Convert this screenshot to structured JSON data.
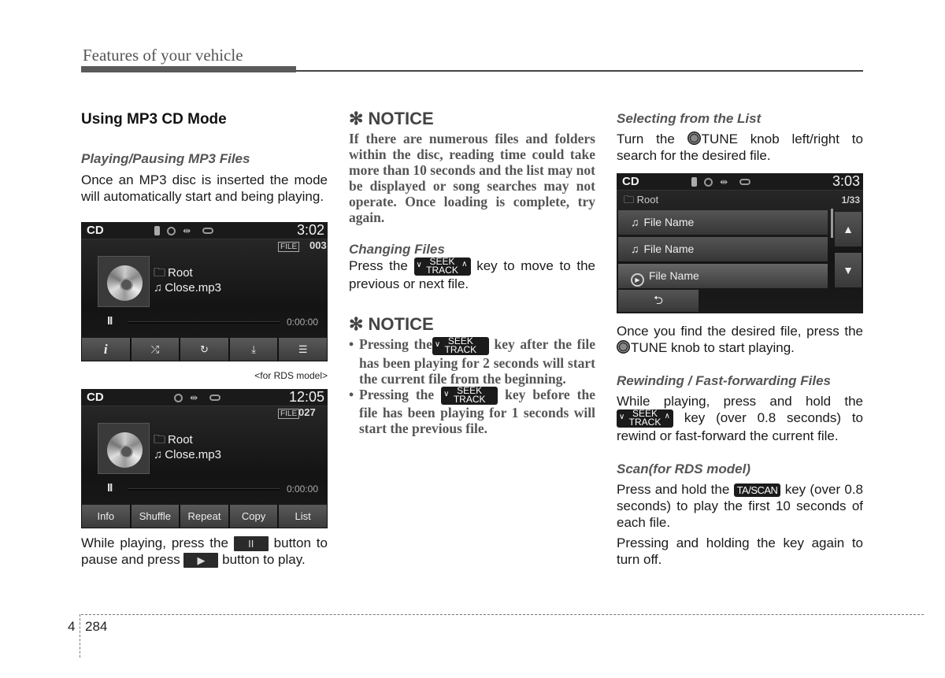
{
  "header": {
    "title": "Features of your vehicle"
  },
  "col1": {
    "section_title": "Using MP3 CD Mode",
    "subhead_play": "Playing/Pausing MP3 Files",
    "intro": "Once an MP3 disc is inserted the mode will automatically start and being playing.",
    "screen1": {
      "mode": "CD",
      "time": "3:02",
      "file_badge": "FILE",
      "file_number": "003",
      "folder": "Root",
      "track": "Close.mp3",
      "elapsed": "0:00:00",
      "pause_glyph": "II",
      "buttons": [
        {
          "name": "info",
          "label": "i"
        },
        {
          "name": "shuffle",
          "label": "⤮"
        },
        {
          "name": "repeat",
          "label": "↻"
        },
        {
          "name": "copy",
          "label": "⤓"
        },
        {
          "name": "list",
          "label": "☰"
        }
      ]
    },
    "caption_rds": "<for RDS model>",
    "screen2": {
      "mode": "CD",
      "time": "12:05",
      "file_badge": "FILE",
      "file_number": "027",
      "folder": "Root",
      "track": "Close.mp3",
      "elapsed": "0:00:00",
      "pause_glyph": "II",
      "buttons": [
        {
          "name": "info",
          "label": "Info"
        },
        {
          "name": "shuffle",
          "label": "Shuffle"
        },
        {
          "name": "repeat",
          "label": "Repeat"
        },
        {
          "name": "copy",
          "label": "Copy"
        },
        {
          "name": "list",
          "label": "List"
        }
      ]
    },
    "pause_text_1": "While playing, press the",
    "pause_text_2": "button to pause and press",
    "pause_text_3": "button to play.",
    "pause_key": "II",
    "play_key": "▶"
  },
  "col2": {
    "notice1_title": "✻ NOTICE",
    "notice1_text": "If there are numerous files and folders within the disc, reading time could take more than 10 seconds and the list may not be displayed or song searches may not operate. Once loading is complete, try again.",
    "subhead_change": "Changing Files",
    "change_pre": "Press the",
    "change_post": "key to move to the previous or next file.",
    "notice2_title": "✻ NOTICE",
    "notice2_items": [
      {
        "pre": "Pressing the",
        "post": "key after the file has been playing for 2 seconds will start the current file from the beginning."
      },
      {
        "pre": "Pressing the",
        "post": "key before the file has been playing for 1 seconds will start the previous file."
      }
    ]
  },
  "keys": {
    "seek_top": "SEEK",
    "seek_bottom": "TRACK",
    "ta_scan": "TA/SCAN",
    "tune": "TUNE"
  },
  "col3": {
    "subhead_select": "Selecting from the List",
    "select_pre": "Turn the",
    "select_post": "knob left/right to search for the desired file.",
    "list_screen": {
      "mode": "CD",
      "time": "3:03",
      "folder": "Root",
      "count": "1/33",
      "items": [
        {
          "label": "File Name",
          "icon": "music-note"
        },
        {
          "label": "File Name",
          "icon": "music-note"
        },
        {
          "label": "File Name",
          "icon": "play-circle"
        }
      ],
      "up": "▲",
      "down": "▼",
      "back": "⮌"
    },
    "found_pre": "Once you find the desired file, press the",
    "found_post": "knob to start playing.",
    "subhead_rewind": "Rewinding / Fast-forwarding Files",
    "rewind_pre": "While playing, press and hold the",
    "rewind_post": "key (over 0.8 seconds) to rewind or fast-forward the current file.",
    "subhead_scan": "Scan(for RDS model)",
    "scan_pre": "Press and hold the",
    "scan_post": "key (over 0.8 seconds) to play the first 10 seconds of each file.",
    "scan_off": "Pressing and holding the key again to turn off."
  },
  "footer": {
    "chapter": "4",
    "page": "284"
  }
}
